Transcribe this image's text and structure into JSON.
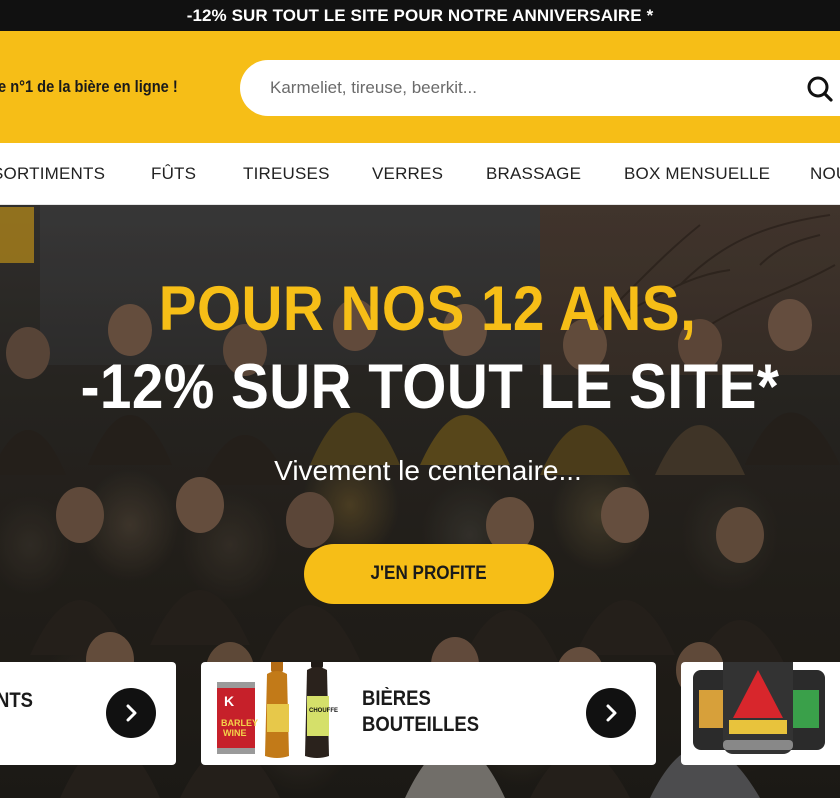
{
  "promo_bar": {
    "text": "-12% SUR TOUT LE SITE POUR NOTRE ANNIVERSAIRE *"
  },
  "header": {
    "tagline": "e n°1 de la bière en ligne !",
    "search": {
      "placeholder": "Karmeliet, tireuse, beerkit...",
      "icon": "search-icon"
    }
  },
  "nav": {
    "items": [
      {
        "label": "SORTIMENTS"
      },
      {
        "label": "FÛTS"
      },
      {
        "label": "TIREUSES"
      },
      {
        "label": "VERRES"
      },
      {
        "label": "BRASSAGE"
      },
      {
        "label": "BOX MENSUELLE"
      },
      {
        "label": "NOU"
      }
    ]
  },
  "hero": {
    "title_line1": "POUR NOS 12 ANS,",
    "title_line2": "-12% SUR TOUT LE SITE*",
    "subtitle": "Vivement le centenaire...",
    "cta_label": "J'EN PROFITE"
  },
  "categories": [
    {
      "label": "NTS",
      "icon": "chevron-right-icon"
    },
    {
      "label_line1": "BIÈRES",
      "label_line2": "BOUTEILLES",
      "icon": "chevron-right-icon",
      "products": {
        "can_brand": "K",
        "can_text_1": "BARLEY",
        "can_text_2": "WINE",
        "bottle_label": "CHOUFFE"
      }
    },
    {
      "label": "",
      "products": "beer kegs"
    }
  ],
  "colors": {
    "brand_yellow": "#f6be17",
    "promo_black": "#111111",
    "nav_white": "#ffffff"
  }
}
